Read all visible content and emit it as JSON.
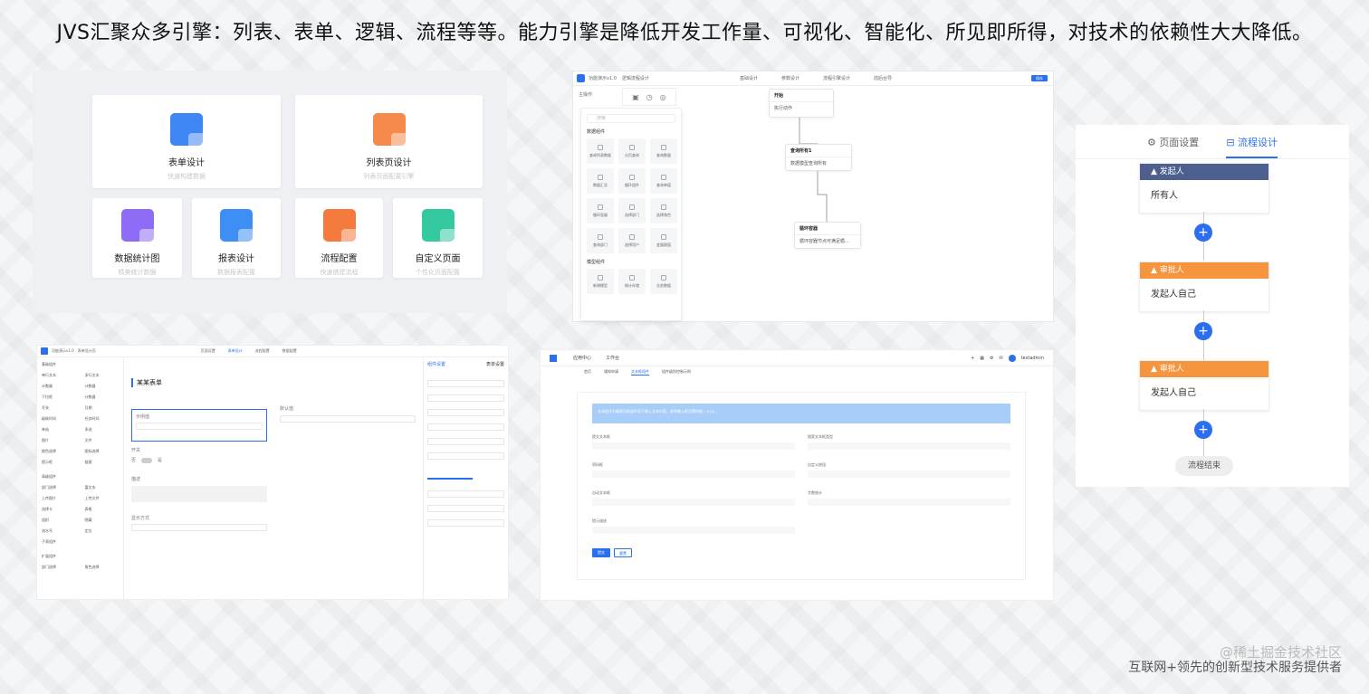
{
  "headline": "JVS汇聚众多引擎：列表、表单、逻辑、流程等等。能力引擎是降低开发工作量、可视化、智能化、所见即所得，对技术的依赖性大大降低。",
  "watermark": "@稀土掘金技术社区",
  "footer": "互联网+领先的创新型技术服务提供者",
  "engines": {
    "cards": [
      {
        "title": "表单设计",
        "sub": "快速构建数据",
        "color": "#3f86f5"
      },
      {
        "title": "列表页设计",
        "sub": "列表页面配置引擎",
        "color": "#f58a4b"
      },
      {
        "title": "数据统计图",
        "sub": "精美统计数据",
        "color": "#8e6cf5"
      },
      {
        "title": "报表设计",
        "sub": "数据报表配置",
        "color": "#3d8ff5"
      },
      {
        "title": "流程配置",
        "sub": "快速搭建流程",
        "color": "#f57a3d"
      },
      {
        "title": "自定义页面",
        "sub": "个性化页面配置",
        "color": "#35c9a2"
      }
    ]
  },
  "flow": {
    "app_title": "功能演示v1.0",
    "crumb": "逻辑流程设计",
    "nav": [
      "基础设计",
      "参数设计",
      "流程引擎设计",
      "前后台导"
    ],
    "save": "保存",
    "tab": "主操作",
    "search_placeholder": "搜索",
    "groups": [
      {
        "title": "数据组件",
        "items": [
          "查询列表数据",
          "分页查询",
          "查询数量",
          "数据汇总",
          "循环组件",
          "查询单值",
          "循环容器",
          "选择部门",
          "选择角色",
          "查询部门",
          "选择用户",
          "变量赋值"
        ]
      },
      {
        "title": "模型组件",
        "items": [
          "新增模型",
          "统计存储",
          "业务数据"
        ]
      }
    ],
    "nodes": [
      {
        "head": "开始",
        "body": "执行动作"
      },
      {
        "head": "查询所有1",
        "body": "数据模型查询所有"
      },
      {
        "head": "循环容器",
        "body": "循环容器节点可满足循..."
      }
    ]
  },
  "process": {
    "tabs": [
      "页面设置",
      "流程设计"
    ],
    "cards": [
      {
        "header": "发起人",
        "body": "所有人",
        "color": "#4d5f8e"
      },
      {
        "header": "审批人",
        "body": "发起人自己",
        "color": "#f5953d"
      },
      {
        "header": "审批人",
        "body": "发起人自己",
        "color": "#f5953d"
      }
    ],
    "plus": "+",
    "end": "流程结束"
  },
  "form": {
    "app_title": "功能演示v1.0",
    "crumb": "表单设计页",
    "tabs": [
      "页面设置",
      "表单设计",
      "流程配置",
      "数据配置"
    ],
    "form_title": "某某表单",
    "right_title": "组件设置",
    "right_title2": "表单设置",
    "left_groups": [
      {
        "title": "基础组件",
        "rows": [
          [
            "单行文本",
            "多行文本"
          ],
          [
            "计数器",
            "计数器"
          ],
          [
            "下拉框",
            "计数器"
          ],
          [
            "开关",
            "日期"
          ],
          [
            "级联时间",
            "任务时间"
          ],
          [
            "单选",
            "多选"
          ],
          [
            "图片",
            "文件"
          ],
          [
            "颜色选择",
            "图标选择"
          ],
          [
            "提示框",
            "链接"
          ]
        ]
      },
      {
        "title": "高级组件",
        "rows": [
          [
            "部门选择",
            "富文本"
          ],
          [
            "上传图片",
            "上传文件"
          ],
          [
            "选择卡",
            "表格"
          ],
          [
            "组织",
            "隐藏"
          ],
          [
            "流水号",
            "定位"
          ],
          [
            "子表组件",
            ""
          ]
        ]
      },
      {
        "title": "扩展组件",
        "rows": [
          [
            "部门选择",
            "角色选择"
          ]
        ]
      }
    ],
    "fields": [
      "示例值",
      "默认值",
      "开关",
      "否",
      "是",
      "描述",
      "显示方式",
      "请选择"
    ]
  },
  "app": {
    "menu": [
      "应用中心",
      "工作台"
    ],
    "user": "testadmin",
    "tabs": [
      "首页",
      "通知申请",
      "文本框组件",
      "组件级别控制示例"
    ],
    "alert": "文本框作为最常见的组件用于输入文本内容，各种输入框设置的统一入口。",
    "labels": [
      "提交文本框",
      "搜索文本框类型",
      "密码框",
      "自定义按钮",
      "自动文本框",
      "字数统计",
      "提示描述"
    ],
    "btn_ok": "提交",
    "btn_reset": "重置"
  }
}
